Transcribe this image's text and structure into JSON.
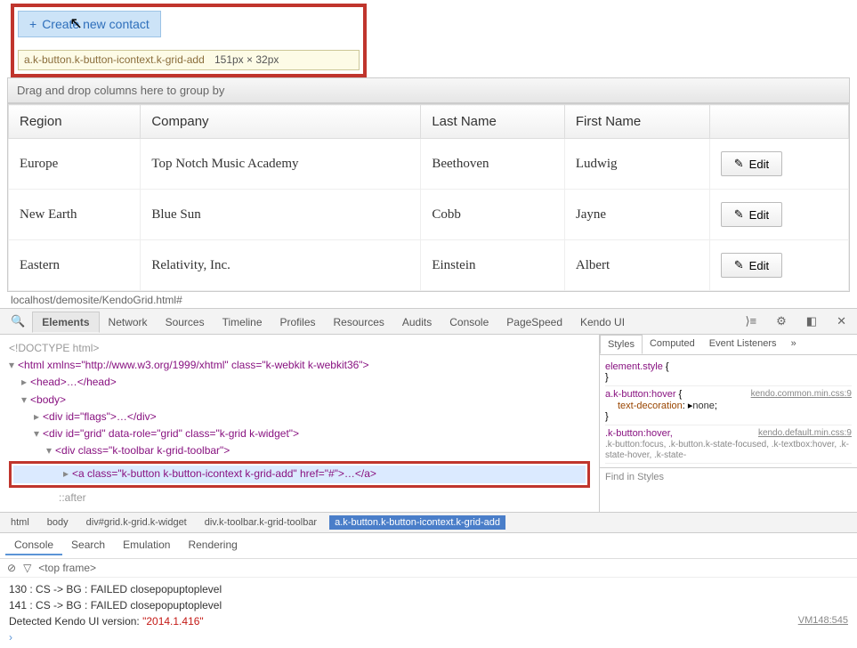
{
  "toolbar": {
    "create_label": "Create new contact",
    "tooltip_selector": "a.k-button.k-button-icontext.k-grid-add",
    "tooltip_dims": "151px × 32px"
  },
  "group_header": "Drag and drop columns here to group by",
  "grid": {
    "columns": [
      "Region",
      "Company",
      "Last Name",
      "First Name",
      ""
    ],
    "edit_label": "Edit",
    "rows": [
      {
        "region": "Europe",
        "company": "Top Notch Music Academy",
        "last": "Beethoven",
        "first": "Ludwig"
      },
      {
        "region": "New Earth",
        "company": "Blue Sun",
        "last": "Cobb",
        "first": "Jayne"
      },
      {
        "region": "Eastern",
        "company": "Relativity, Inc.",
        "last": "Einstein",
        "first": "Albert"
      }
    ]
  },
  "url": "localhost/demosite/KendoGrid.html#",
  "devtools": {
    "tabs": [
      "Elements",
      "Network",
      "Sources",
      "Timeline",
      "Profiles",
      "Resources",
      "Audits",
      "Console",
      "PageSpeed",
      "Kendo UI"
    ],
    "active_tab": "Elements",
    "dom": {
      "doctype": "<!DOCTYPE html>",
      "html_open": "<html xmlns=\"http://www.w3.org/1999/xhtml\" class=\"k-webkit k-webkit36\">",
      "head": "<head>…</head>",
      "body_open": "<body>",
      "flags": "<div id=\"flags\">…</div>",
      "grid_div": "<div id=\"grid\" data-role=\"grid\" class=\"k-grid k-widget\">",
      "toolbar_div": "<div class=\"k-toolbar k-grid-toolbar\">",
      "anchor": "<a class=\"k-button k-button-icontext k-grid-add\" href=\"#\">…</a>",
      "after": "::after"
    },
    "breadcrumb": [
      "html",
      "body",
      "div#grid.k-grid.k-widget",
      "div.k-toolbar.k-grid-toolbar",
      "a.k-button.k-button-icontext.k-grid-add"
    ],
    "styles_tabs": [
      "Styles",
      "Computed",
      "Event Listeners"
    ],
    "styles": {
      "rule1_sel": "element.style",
      "rule2_sel": "a.k-button:hover",
      "rule2_src": "kendo.common.min.css:9",
      "rule2_prop": "text-decoration",
      "rule2_val": "none",
      "rule3_sel": ".k-button:hover,",
      "rule3_src": "kendo.default.min.css:9",
      "rule3_more": ".k-button:focus, .k-button.k-state-focused, .k-textbox:hover, .k-state-hover, .k-state-"
    },
    "find_styles": "Find in Styles",
    "console_tabs": [
      "Console",
      "Search",
      "Emulation",
      "Rendering"
    ],
    "console_top_frame": "<top frame>",
    "console_lines": [
      "130 : CS -> BG : FAILED closepopuptoplevel",
      "141 : CS -> BG : FAILED closepopuptoplevel"
    ],
    "console_detect_prefix": "Detected Kendo UI version: ",
    "console_detect_version": "\"2014.1.416\"",
    "console_src": "VM148:545"
  }
}
